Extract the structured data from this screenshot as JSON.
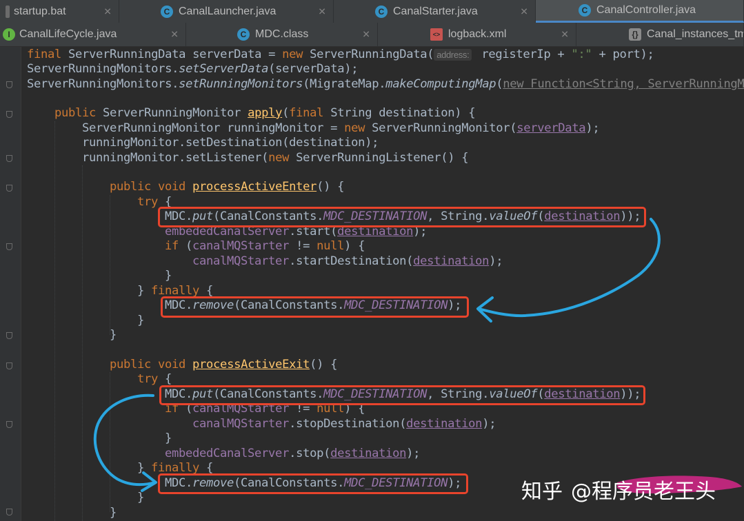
{
  "tabs_row1": [
    {
      "label": "startup.bat",
      "icon": "bat-file-icon",
      "active": false
    },
    {
      "label": "CanalLauncher.java",
      "icon": "java-class-icon",
      "active": false
    },
    {
      "label": "CanalStarter.java",
      "icon": "java-class-icon",
      "active": false
    },
    {
      "label": "CanalController.java",
      "icon": "java-class-icon",
      "active": true
    }
  ],
  "tabs_row2": [
    {
      "label": "CanalLifeCycle.java",
      "icon": "java-interface-icon",
      "active": false
    },
    {
      "label": "MDC.class",
      "icon": "class-file-icon",
      "active": false
    },
    {
      "label": "logback.xml",
      "icon": "xml-file-icon",
      "active": false
    },
    {
      "label": "Canal_instances_tm",
      "icon": "instances-file-icon",
      "active": false
    }
  ],
  "code": {
    "l1": {
      "a": "final ",
      "b": "ServerRunningData serverData = ",
      "c": "new ",
      "d": "ServerRunningData(",
      "hint": "address:",
      "e": " registerIp + ",
      "f": "\":\"",
      "g": " + port);"
    },
    "l2": {
      "a": "ServerRunningMonitors.",
      "b": "setServerData",
      "c": "(serverData);"
    },
    "l3": {
      "a": "ServerRunningMonitors.",
      "b": "setRunningMonitors",
      "c": "(MigrateMap.",
      "d": "makeComputingMap",
      "e": "(",
      "f": "new Function<String, ServerRunningMo"
    },
    "l5": {
      "a": "public ",
      "b": "ServerRunningMonitor ",
      "c": "apply",
      "d": "(",
      "e": "final ",
      "f": "String destination) {"
    },
    "l6": {
      "a": "ServerRunningMonitor runningMonitor = ",
      "b": "new ",
      "c": "ServerRunningMonitor(",
      "d": "serverData",
      "e": ");"
    },
    "l7": {
      "a": "runningMonitor.setDestination(destination);"
    },
    "l8": {
      "a": "runningMonitor.setListener(",
      "b": "new ",
      "c": "ServerRunningListener() {"
    },
    "l10": {
      "a": "public void ",
      "b": "processActiveEnter",
      "c": "() {"
    },
    "l11": {
      "a": "try ",
      "b": "{"
    },
    "l12": {
      "a": "MDC.",
      "b": "put",
      "c": "(CanalConstants.",
      "d": "MDC_DESTINATION",
      "e": ", String.",
      "f": "valueOf",
      "g": "(",
      "h": "destination",
      "i": "));"
    },
    "l13": {
      "a": "embededCanalServer",
      "b": ".start(",
      "c": "destination",
      "d": ");"
    },
    "l14": {
      "a": "if ",
      "b": "(",
      "c": "canalMQStarter",
      "d": " != ",
      "e": "null",
      "f": ") {"
    },
    "l15": {
      "a": "canalMQStarter",
      "b": ".startDestination(",
      "c": "destination",
      "d": ");"
    },
    "l16": {
      "a": "}"
    },
    "l17": {
      "a": "} ",
      "b": "finally ",
      "c": "{"
    },
    "l18": {
      "a": "MDC.",
      "b": "remove",
      "c": "(CanalConstants.",
      "d": "MDC_DESTINATION",
      "e": ");"
    },
    "l19": {
      "a": "}"
    },
    "l20": {
      "a": "}"
    },
    "l22": {
      "a": "public void ",
      "b": "processActiveExit",
      "c": "() {"
    },
    "l23": {
      "a": "try ",
      "b": "{"
    },
    "l24": {
      "a": "MDC.",
      "b": "put",
      "c": "(CanalConstants.",
      "d": "MDC_DESTINATION",
      "e": ", String.",
      "f": "valueOf",
      "g": "(",
      "h": "destination",
      "i": "));"
    },
    "l25": {
      "a": "if ",
      "b": "(",
      "c": "canalMQStarter",
      "d": " != ",
      "e": "null",
      "f": ") {"
    },
    "l26": {
      "a": "canalMQStarter",
      "b": ".stopDestination(",
      "c": "destination",
      "d": ");"
    },
    "l27": {
      "a": "}"
    },
    "l28": {
      "a": "embededCanalServer",
      "b": ".stop(",
      "c": "destination",
      "d": ");"
    },
    "l29": {
      "a": "} ",
      "b": "finally ",
      "c": "{"
    },
    "l30": {
      "a": "MDC.",
      "b": "remove",
      "c": "(CanalConstants.",
      "d": "MDC_DESTINATION",
      "e": ");"
    },
    "l31": {
      "a": "}"
    },
    "l32": {
      "a": "}"
    }
  },
  "watermark": {
    "brand": "知乎",
    "handle": "@程序员老王头"
  },
  "colors": {
    "highlight_box": "#e8442c",
    "arrow": "#2aa6e0",
    "keyword": "#cc7832",
    "method_decl": "#ffc66d",
    "field": "#9876aa",
    "text": "#a9b7c6"
  }
}
